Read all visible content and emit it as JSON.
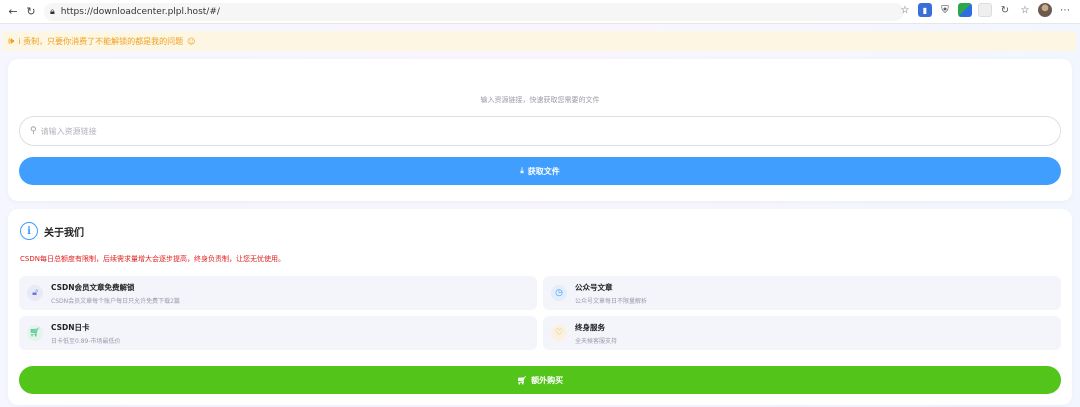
{
  "browser": {
    "url": "https://downloadcenter.plpl.host/#/"
  },
  "notice": {
    "text": "i 责制，只要你消费了不能解锁的都是我的问题"
  },
  "download": {
    "hint": "输入资源链接，快速获取您需要的文件",
    "input_placeholder": "请输入资源链接",
    "input_value": "",
    "button_label": "获取文件"
  },
  "about": {
    "title": "关于我们",
    "warning": "CSDN每日总额度有限制，后续需求量增大会逐步提高，终身负责制，让您无忧使用。",
    "features": [
      {
        "title": "CSDN会员文章免费解锁",
        "desc": "CSDN会员文章每个账户每日只允许免费下载2篇",
        "icon": "lock-icon"
      },
      {
        "title": "公众号文章",
        "desc": "公众号文章每日不限量解析",
        "icon": "clock-icon"
      },
      {
        "title": "CSDN日卡",
        "desc": "日卡低至0.89-市场最低价",
        "icon": "cart-icon"
      },
      {
        "title": "终身服务",
        "desc": "全天候客服支持",
        "icon": "heart-icon"
      }
    ],
    "buy_button_label": "额外购买"
  },
  "colors": {
    "primary": "#409eff",
    "success": "#52c41a",
    "danger": "#e02020",
    "warning": "#f0a020"
  }
}
